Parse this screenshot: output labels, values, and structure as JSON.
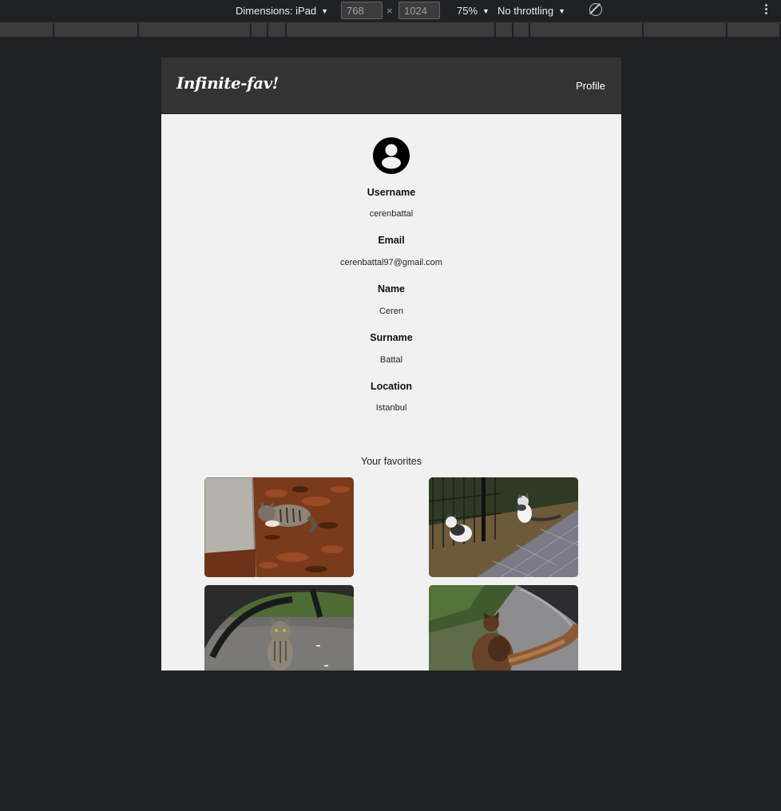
{
  "devtools": {
    "dimensions_label": "Dimensions: iPad",
    "width": "768",
    "times": "×",
    "height": "1024",
    "zoom": "75%",
    "throttling": "No throttling",
    "rotate_icon": "rotate-icon",
    "more_icon": "kebab-menu-icon"
  },
  "navbar": {
    "brand": "Infinite-fav!",
    "profile_link": "Profile"
  },
  "profile": {
    "avatar_icon": "user-circle-icon",
    "fields": [
      {
        "label": "Username",
        "value": "cerenbattal"
      },
      {
        "label": "Email",
        "value": "cerenbattal97@gmail.com"
      },
      {
        "label": "Name",
        "value": "Ceren"
      },
      {
        "label": "Surname",
        "value": "Battal"
      },
      {
        "label": "Location",
        "value": "Istanbul"
      }
    ]
  },
  "favorites": {
    "title": "Your favorites"
  },
  "colors": {
    "page_background": "#202124",
    "navbar": "#333333",
    "viewport_background": "#f1f1f1"
  }
}
